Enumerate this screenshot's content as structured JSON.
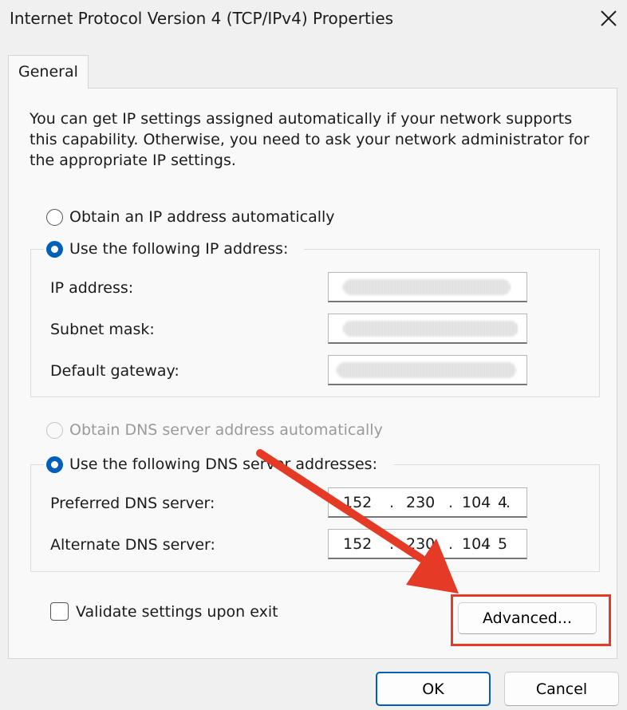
{
  "window": {
    "title": "Internet Protocol Version 4 (TCP/IPv4) Properties",
    "close_icon": "close-icon"
  },
  "tabs": [
    {
      "label": "General"
    }
  ],
  "description": "You can get IP settings assigned automatically if your network supports this capability. Otherwise, you need to ask your network administrator for the appropriate IP settings.",
  "ip_section": {
    "auto_option": {
      "label": "Obtain an IP address automatically",
      "selected": false
    },
    "manual_option": {
      "label": "Use the following IP address:",
      "selected": true
    },
    "fields": [
      {
        "label": "IP address:"
      },
      {
        "label": "Subnet mask:"
      },
      {
        "label": "Default gateway:"
      }
    ]
  },
  "dns_section": {
    "auto_option": {
      "label": "Obtain DNS server address automatically",
      "selected": false,
      "disabled": true
    },
    "manual_option": {
      "label": "Use the following DNS server addresses:",
      "selected": true
    },
    "preferred": {
      "label": "Preferred DNS server:",
      "octets": [
        "152",
        "230",
        "104",
        "4"
      ]
    },
    "alternate": {
      "label": "Alternate DNS server:",
      "octets": [
        "152",
        "230",
        "104",
        "5"
      ]
    }
  },
  "validate": {
    "label": "Validate settings upon exit",
    "checked": false
  },
  "buttons": {
    "advanced": "Advanced...",
    "ok": "OK",
    "cancel": "Cancel"
  },
  "colors": {
    "accent": "#005fb8",
    "annotation": "#e53a25"
  }
}
